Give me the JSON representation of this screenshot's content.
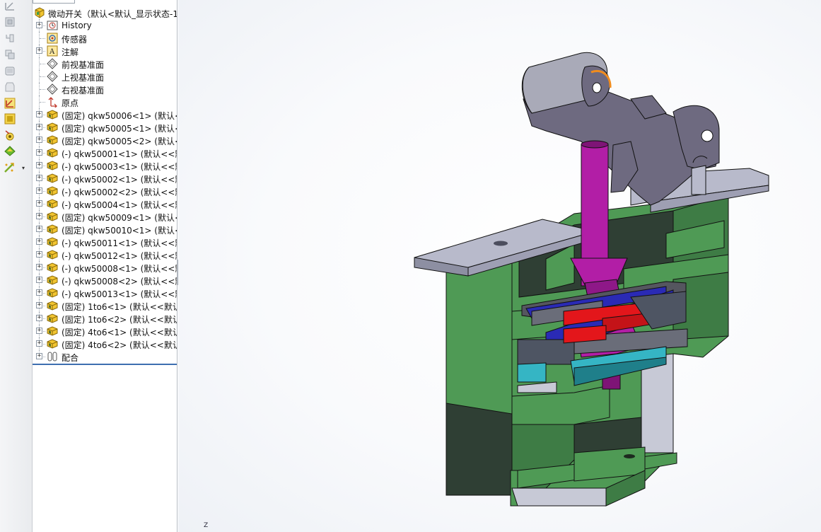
{
  "toolbar": {
    "tools": [
      {
        "name": "smart-dimension-icon"
      },
      {
        "name": "mate-icon"
      },
      {
        "name": "insert-component-icon"
      },
      {
        "name": "linear-pattern-icon"
      },
      {
        "name": "move-component-icon"
      },
      {
        "name": "show-hidden-icon"
      },
      {
        "name": "assembly-features-icon"
      },
      {
        "name": "reference-geometry-icon"
      },
      {
        "name": "new-motion-study-icon"
      },
      {
        "name": "bill-of-materials-icon"
      },
      {
        "name": "exploded-view-icon"
      }
    ]
  },
  "tree": {
    "root": {
      "label": "微动开关（默认<默认_显示状态-1",
      "icon": "assembly-icon"
    },
    "items": [
      {
        "label": "History",
        "icon": "history-icon",
        "expandable": true
      },
      {
        "label": "传感器",
        "icon": "sensor-icon",
        "expandable": false
      },
      {
        "label": "注解",
        "icon": "annotation-icon",
        "expandable": true
      },
      {
        "label": "前视基准面",
        "icon": "plane-icon",
        "expandable": false
      },
      {
        "label": "上视基准面",
        "icon": "plane-icon",
        "expandable": false
      },
      {
        "label": "右视基准面",
        "icon": "plane-icon",
        "expandable": false
      },
      {
        "label": "原点",
        "icon": "origin-icon",
        "expandable": false
      },
      {
        "label": "(固定) qkw50006<1> (默认<",
        "icon": "part-icon",
        "expandable": true
      },
      {
        "label": "(固定) qkw50005<1> (默认<",
        "icon": "part-icon",
        "expandable": true
      },
      {
        "label": "(固定) qkw50005<2> (默认<",
        "icon": "part-icon",
        "expandable": true
      },
      {
        "label": "(-) qkw50001<1> (默认<<默",
        "icon": "part-icon",
        "expandable": true
      },
      {
        "label": "(-) qkw50003<1> (默认<<默",
        "icon": "part-icon",
        "expandable": true
      },
      {
        "label": "(-) qkw50002<1> (默认<<默",
        "icon": "part-icon",
        "expandable": true
      },
      {
        "label": "(-) qkw50002<2> (默认<<默",
        "icon": "part-icon",
        "expandable": true
      },
      {
        "label": "(-) qkw50004<1> (默认<<默",
        "icon": "part-icon",
        "expandable": true
      },
      {
        "label": "(固定) qkw50009<1> (默认<",
        "icon": "part-icon",
        "expandable": true
      },
      {
        "label": "(固定) qkw50010<1> (默认<",
        "icon": "part-icon",
        "expandable": true
      },
      {
        "label": "(-) qkw50011<1> (默认<<默",
        "icon": "part-icon",
        "expandable": true
      },
      {
        "label": "(-) qkw50012<1> (默认<<默",
        "icon": "part-icon",
        "expandable": true
      },
      {
        "label": "(-) qkw50008<1> (默认<<默",
        "icon": "part-icon",
        "expandable": true
      },
      {
        "label": "(-) qkw50008<2> (默认<<默",
        "icon": "part-icon",
        "expandable": true
      },
      {
        "label": "(-) qkw50013<1> (默认<<默",
        "icon": "part-icon",
        "expandable": true
      },
      {
        "label": "(固定) 1to6<1> (默认<<默认",
        "icon": "part-icon",
        "expandable": true
      },
      {
        "label": "(固定) 1to6<2> (默认<<默认",
        "icon": "part-icon",
        "expandable": true
      },
      {
        "label": "(固定) 4to6<1> (默认<<默认",
        "icon": "part-icon",
        "expandable": true
      },
      {
        "label": "(固定) 4to6<2> (默认<<默认",
        "icon": "part-icon",
        "expandable": true
      },
      {
        "label": "配合",
        "icon": "mates-icon",
        "expandable": true
      }
    ]
  },
  "viewport": {
    "triad_label": "Z",
    "colors": {
      "housing": "#4f9a55",
      "housing_dark": "#2f3f34",
      "plate": "#b8bacb",
      "lever": "#6e6a80",
      "roller": "#a9aab8",
      "plunger": "#b21ea6",
      "slider": "#2a2ab5",
      "contact": "#e3161b",
      "base_block": "#4e5563",
      "spring_cyan": "#35b5c4",
      "highlight_edge": "#f08c1e"
    }
  }
}
